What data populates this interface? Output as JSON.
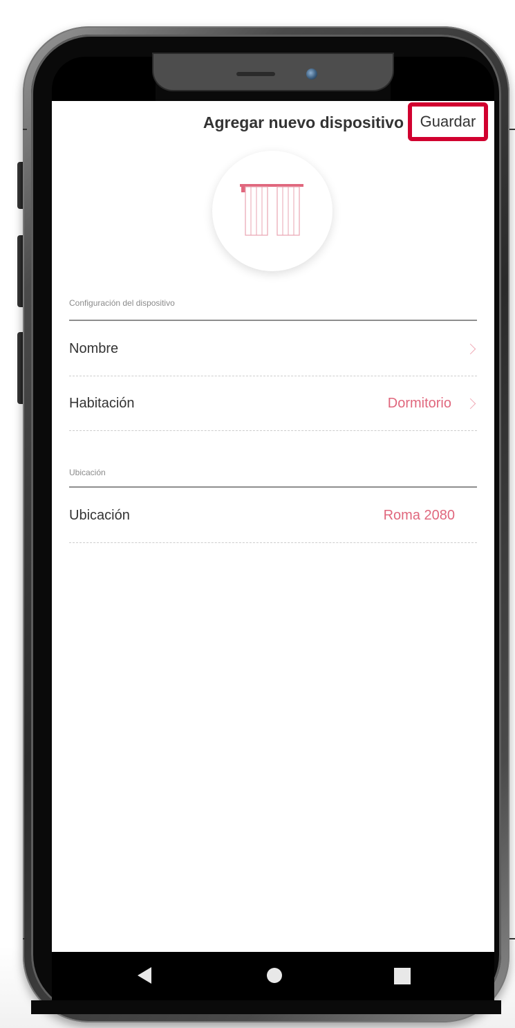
{
  "header": {
    "title": "Agregar nuevo dispositivo",
    "save_label": "Guardar"
  },
  "device": {
    "icon": "curtain-icon",
    "accent_color": "#e0677d"
  },
  "sections": {
    "config": {
      "label": "Configuración del dispositivo",
      "rows": [
        {
          "label": "Nombre",
          "value": ""
        },
        {
          "label": "Habitación",
          "value": "Dormitorio"
        }
      ]
    },
    "location": {
      "label": "Ubicación",
      "rows": [
        {
          "label": "Ubicación",
          "value": "Roma 2080"
        }
      ]
    }
  },
  "navbar": {
    "back_icon": "triangle-back-icon",
    "home_icon": "circle-home-icon",
    "recent_icon": "square-recent-icon"
  },
  "colors": {
    "highlight_border": "#d1002f",
    "value_text": "#e0677d",
    "chevron": "#f0a9b5"
  }
}
